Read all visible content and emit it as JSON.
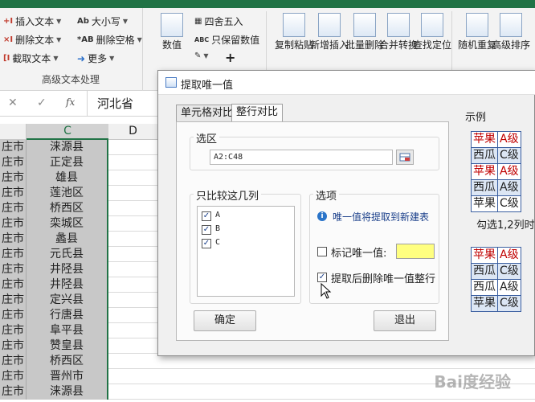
{
  "ribbon": {
    "text_group": {
      "items": [
        "插入文本",
        "删除文本",
        "截取文本",
        "大小写",
        "删除空格",
        "更多"
      ],
      "label": "高级文本处理"
    },
    "numeric_group": {
      "big_label": "数值",
      "items": [
        "四舍五入",
        "只保留数值"
      ],
      "plus": "+"
    },
    "big_buttons": [
      "复制粘贴",
      "新增插入",
      "批量删除",
      "合并转换",
      "查找定位",
      "随机重复",
      "高级排序"
    ]
  },
  "formula_bar": {
    "cancel": "✕",
    "confirm": "✓",
    "fx": "fx",
    "value": "河北省"
  },
  "columns": {
    "c": "C",
    "d": "D"
  },
  "rows": [
    {
      "a": "庄市",
      "c": "涞源县"
    },
    {
      "a": "庄市",
      "c": "正定县"
    },
    {
      "a": "庄市",
      "c": "雄县"
    },
    {
      "a": "庄市",
      "c": "莲池区"
    },
    {
      "a": "庄市",
      "c": "桥西区"
    },
    {
      "a": "庄市",
      "c": "栾城区"
    },
    {
      "a": "庄市",
      "c": "蠡县"
    },
    {
      "a": "庄市",
      "c": "元氏县"
    },
    {
      "a": "庄市",
      "c": "井陉县"
    },
    {
      "a": "庄市",
      "c": "井陉县"
    },
    {
      "a": "庄市",
      "c": "定兴县"
    },
    {
      "a": "庄市",
      "c": "行唐县"
    },
    {
      "a": "庄市",
      "c": "阜平县"
    },
    {
      "a": "庄市",
      "c": "赞皇县"
    },
    {
      "a": "庄市",
      "c": "桥西区"
    },
    {
      "a": "庄市",
      "c": "晋州市"
    },
    {
      "a": "庄市",
      "c": "涞源县"
    }
  ],
  "dialog": {
    "title": "提取唯一值",
    "tabs": [
      "单元格对比",
      "整行对比"
    ],
    "range_section": "选区",
    "range_value": "A2:C48",
    "compare_section": "只比较这几列",
    "columns": [
      "A",
      "B",
      "C"
    ],
    "options_section": "选项",
    "info_text": "唯一值将提取到新建表",
    "mark_label": "标记唯一值:",
    "mark_color": "#ffff80",
    "delete_label": "提取后删除唯一值整行",
    "ok": "确定",
    "cancel": "退出",
    "example_label": "示例",
    "example_table1": [
      [
        "苹果",
        "A级"
      ],
      [
        "西瓜",
        "C级"
      ],
      [
        "苹果",
        "A级"
      ],
      [
        "西瓜",
        "A级"
      ],
      [
        "苹果",
        "C级"
      ]
    ],
    "example_note": "勾选1,2列时",
    "example_table2": [
      [
        "苹果",
        "A级"
      ],
      [
        "西瓜",
        "C级"
      ],
      [
        "西瓜",
        "A级"
      ],
      [
        "苹果",
        "C级"
      ]
    ]
  },
  "watermark": "Bai度经验",
  "colors": {
    "accent": "#217346",
    "highlight_red": "#c00000",
    "table_border": "#3b5fa0"
  }
}
